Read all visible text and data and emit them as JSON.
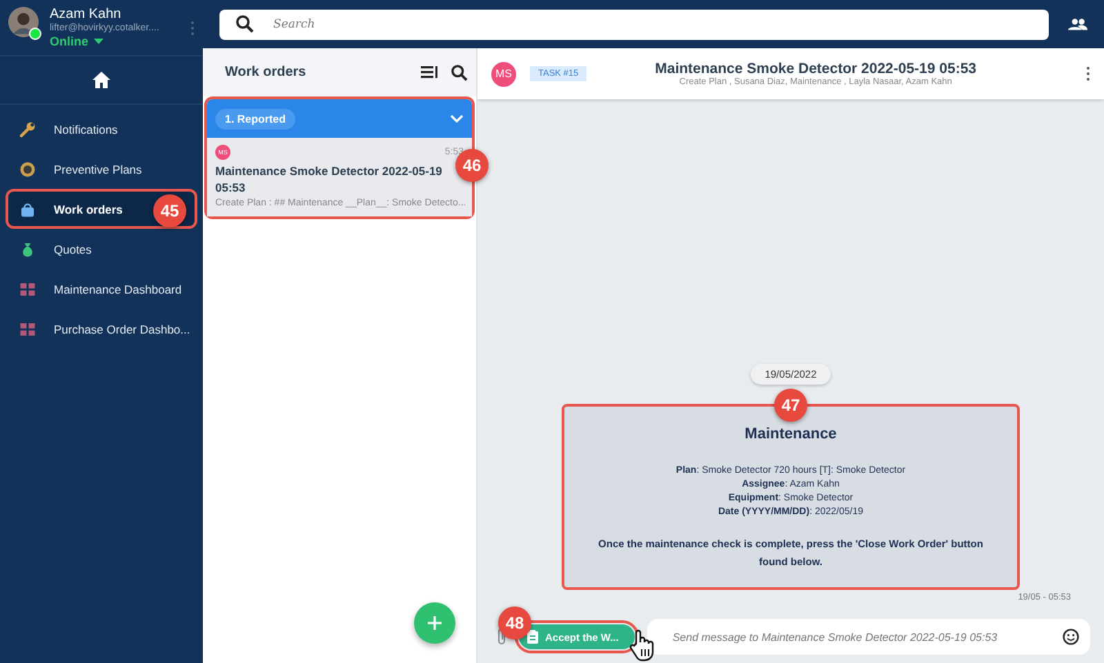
{
  "user": {
    "name": "Azam Kahn",
    "email": "lifter@hovirkyy.cotalker....",
    "status": "Online",
    "online": true
  },
  "search": {
    "placeholder": "Search"
  },
  "nav": [
    {
      "label": "Notifications",
      "selected": false
    },
    {
      "label": "Preventive Plans",
      "selected": false
    },
    {
      "label": "Work orders",
      "selected": true,
      "callout": "45"
    },
    {
      "label": "Quotes",
      "selected": false
    },
    {
      "label": "Maintenance Dashboard",
      "selected": false
    },
    {
      "label": "Purchase Order Dashbo...",
      "selected": false
    }
  ],
  "list": {
    "title": "Work orders",
    "group": {
      "label": "1. Reported",
      "expanded": true,
      "callout": "46"
    },
    "items": [
      {
        "initials": "MS",
        "time": "5:53",
        "title": "Maintenance Smoke Detector 2022-05-19 05:53",
        "preview": "Create Plan : ## Maintenance __Plan__: Smoke Detecto...",
        "selected": true
      }
    ]
  },
  "chat": {
    "avatar": "MS",
    "tag": "TASK #15",
    "title": "Maintenance Smoke Detector 2022-05-19 05:53",
    "subtitle": "Create Plan , Susana Diaz, Maintenance , Layla Nasaar, Azam Kahn",
    "date": "19/05/2022",
    "message": {
      "callout": "47",
      "heading": "Maintenance",
      "lines": [
        "**Plan**: Smoke Detector 720 hours [T]: Smoke Detector",
        "**Assignee**: Azam Kahn",
        "**Equipment**: Smoke Detector",
        "**Date (YYYY/MM/DD)**: 2022/05/19"
      ],
      "note": "Once the maintenance check is complete, press the 'Close Work Order' button found below.",
      "time": "19/05 - 05:53"
    },
    "composer": {
      "action": {
        "label": "Accept the W...",
        "callout": "48"
      },
      "placeholder": "Send message to Maintenance Smoke Detector 2022-05-19 05:53"
    }
  }
}
